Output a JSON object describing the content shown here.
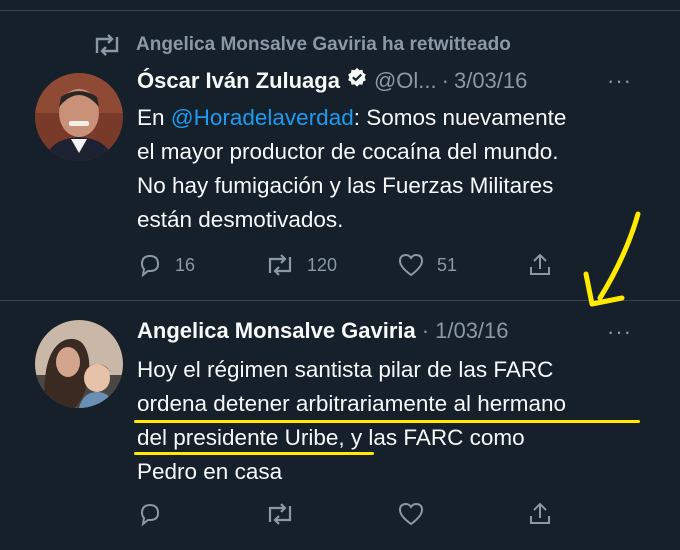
{
  "retweet_banner": {
    "text": "Angelica Monsalve Gaviria ha retwitteado"
  },
  "tweet1": {
    "name": "Óscar Iván Zuluaga",
    "handle": "@Ol...",
    "sep": "·",
    "date": "3/03/16",
    "more": "···",
    "text_pre": "En ",
    "mention": "@Horadelaverdad",
    "text_lines": [
      ": Somos nuevamente",
      "el mayor productor de cocaína del mundo.",
      "No hay fumigación y las Fuerzas Militares",
      "están desmotivados."
    ],
    "actions": {
      "replies": "16",
      "retweets": "120",
      "likes": "51"
    }
  },
  "tweet2": {
    "name": "Angelica Monsalve Gaviria",
    "sep": "·",
    "date": "1/03/16",
    "more": "···",
    "lines": [
      "Hoy el régimen santista pilar de las FARC",
      "ordena detener arbitrariamente al hermano",
      "del presidente Uribe, y las FARC como",
      "Pedro en casa"
    ]
  },
  "colors": {
    "background": "#15202b",
    "accent": "#1d9bf0",
    "muted": "#8b98a5",
    "annotation": "#ffea00"
  }
}
